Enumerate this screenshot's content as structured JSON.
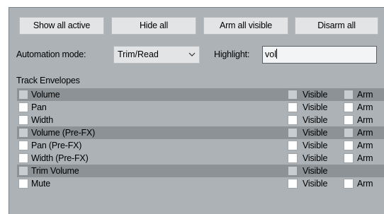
{
  "buttons": {
    "show_all_active": "Show all active",
    "hide_all": "Hide all",
    "arm_all_visible": "Arm all visible",
    "disarm_all": "Disarm all"
  },
  "automation": {
    "label": "Automation mode:",
    "value": "Trim/Read"
  },
  "highlight": {
    "label": "Highlight:",
    "value": "vol"
  },
  "section_title": "Track Envelopes",
  "column_labels": {
    "visible": "Visible",
    "arm": "Arm"
  },
  "envelopes": [
    {
      "name": "Volume",
      "highlighted": true,
      "visible_checked": false,
      "has_arm": true,
      "arm_checked": false
    },
    {
      "name": "Pan",
      "highlighted": false,
      "visible_checked": false,
      "has_arm": true,
      "arm_checked": false
    },
    {
      "name": "Width",
      "highlighted": false,
      "visible_checked": false,
      "has_arm": true,
      "arm_checked": false
    },
    {
      "name": "Volume (Pre-FX)",
      "highlighted": true,
      "visible_checked": false,
      "has_arm": true,
      "arm_checked": false
    },
    {
      "name": "Pan (Pre-FX)",
      "highlighted": false,
      "visible_checked": false,
      "has_arm": true,
      "arm_checked": false
    },
    {
      "name": "Width (Pre-FX)",
      "highlighted": false,
      "visible_checked": false,
      "has_arm": true,
      "arm_checked": false
    },
    {
      "name": "Trim Volume",
      "highlighted": true,
      "visible_checked": false,
      "has_arm": false,
      "arm_checked": false
    },
    {
      "name": "Mute",
      "highlighted": false,
      "visible_checked": false,
      "has_arm": true,
      "arm_checked": false
    }
  ],
  "colors": {
    "panel": "#acb2b6",
    "highlight_row": "#8c9296",
    "button": "#e2e4e6"
  }
}
